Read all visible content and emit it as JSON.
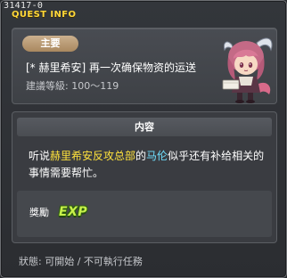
{
  "window": {
    "quest_id": "31417-0",
    "title": "QUEST INFO"
  },
  "header": {
    "tag": "主要",
    "quest_name": "[* 赫里希安] 再一次确保物资的运送",
    "level_range": "建議等級: 100～119",
    "npc_portrait": "npc-portrait-pink-haired-horned-character"
  },
  "content": {
    "section_title": "内容",
    "description": {
      "part1": "听说",
      "place": "赫里希安反攻总部",
      "part2": "的",
      "npc": "马伦",
      "part3": "似乎还有补给相关的事情需要帮忙。"
    },
    "reward_label": "獎勵",
    "reward_exp": "EXP"
  },
  "status": "狀態: 可開始 / 不可執行任務",
  "colors": {
    "title": "#ffd83a",
    "tag_bg": "#b8966b",
    "place_highlight": "#ffe23c",
    "npc_highlight": "#6fe0ff",
    "exp_text": "#c7f04a"
  }
}
